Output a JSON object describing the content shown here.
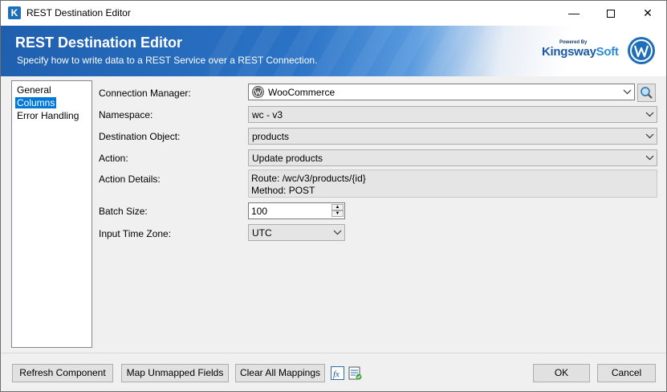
{
  "window": {
    "title": "REST Destination Editor"
  },
  "banner": {
    "title": "REST Destination Editor",
    "subtitle": "Specify how to write data to a REST Service over a REST Connection.",
    "brand_powered": "Powered By",
    "brand_name_a": "Kingsway",
    "brand_name_b": "Soft"
  },
  "nav": {
    "items": [
      {
        "label": "General",
        "selected": false
      },
      {
        "label": "Columns",
        "selected": true
      },
      {
        "label": "Error Handling",
        "selected": false
      }
    ]
  },
  "form": {
    "connection_manager_label": "Connection Manager:",
    "connection_manager_value": "WooCommerce",
    "namespace_label": "Namespace:",
    "namespace_value": "wc - v3",
    "destination_object_label": "Destination Object:",
    "destination_object_value": "products",
    "action_label": "Action:",
    "action_value": "Update products",
    "action_details_label": "Action Details:",
    "action_details_route": "Route: /wc/v3/products/{id}",
    "action_details_method": "Method: POST",
    "batch_size_label": "Batch Size:",
    "batch_size_value": "100",
    "time_zone_label": "Input Time Zone:",
    "time_zone_value": "UTC"
  },
  "footer": {
    "refresh_label": "Refresh Component",
    "map_unmapped_label": "Map Unmapped Fields",
    "clear_mappings_label": "Clear All Mappings",
    "fx_label": "fx",
    "ok_label": "OK",
    "cancel_label": "Cancel"
  },
  "colors": {
    "accent": "#0078d7",
    "banner": "#2b73c6",
    "wordpress": "#1e6fb8"
  }
}
